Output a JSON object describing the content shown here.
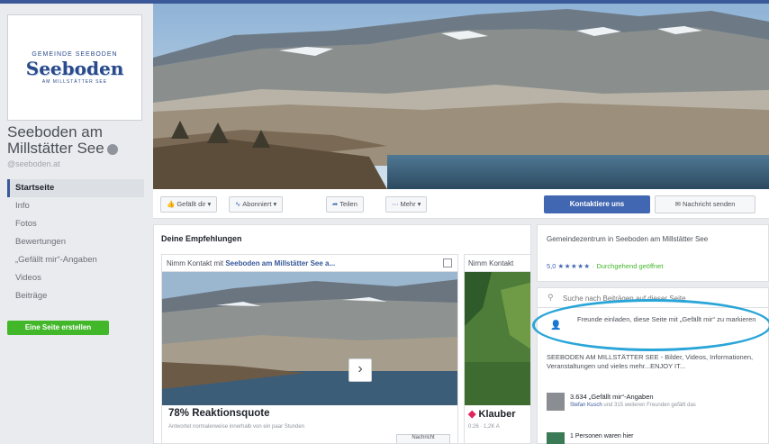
{
  "page": {
    "logo_arc": "GEMEINDE SEEBODEN",
    "logo_word": "Seeboden",
    "logo_sub": "AM MILLSTÄTTER SEE",
    "name": "Seeboden am Millstätter See",
    "handle": "@seeboden.at"
  },
  "nav": {
    "items": [
      {
        "label": "Startseite",
        "active": true
      },
      {
        "label": "Info"
      },
      {
        "label": "Fotos"
      },
      {
        "label": "Bewertungen"
      },
      {
        "label": "„Gefällt mir“-Angaben"
      },
      {
        "label": "Videos"
      },
      {
        "label": "Beiträge"
      }
    ],
    "create_button": "Eine Seite erstellen"
  },
  "actions": {
    "like": "Gefällt dir ▾",
    "follow": "Abonniert ▾",
    "share": "Teilen",
    "more": "Mehr ▾",
    "contact": "Kontaktiere uns",
    "message": "Nachricht senden"
  },
  "recs": {
    "title": "Deine Empfehlungen",
    "card1": {
      "head_prefix": "Nimm Kontakt mit ",
      "head_name": "Seeboden am Millstätter See a...",
      "big": "78% Reaktionsquote",
      "small": "Antwortet normalerweise innerhalb von ein paar Stunden",
      "button": "Nachricht"
    },
    "card2": {
      "head": "Nimm Kontakt",
      "big": "Klauber",
      "small": "0:26 · 1,2K A"
    }
  },
  "right": {
    "info_title": "Gemeindezentrum in Seeboden am Millstätter See",
    "rating_score": "5,0",
    "rating_stars": "★★★★★",
    "rating_open": "· Durchgehend geöffnet",
    "search_placeholder": "Suche nach Beiträgen auf dieser Seite",
    "invite": "Freunde einladen, diese Seite mit „Gefällt mir“ zu markieren",
    "about": "SEEBODEN AM MILLSTÄTTER SEE - Bilder, Videos, Informationen, Veranstaltungen und vieles mehr...ENJOY IT...",
    "likes_title": "3.634 „Gefällt mir“-Angaben",
    "likes_name": "Stefan Kusch",
    "likes_rest": " und 315 weiteren Freunden gefällt das",
    "visits": "1 Personen waren hier"
  }
}
